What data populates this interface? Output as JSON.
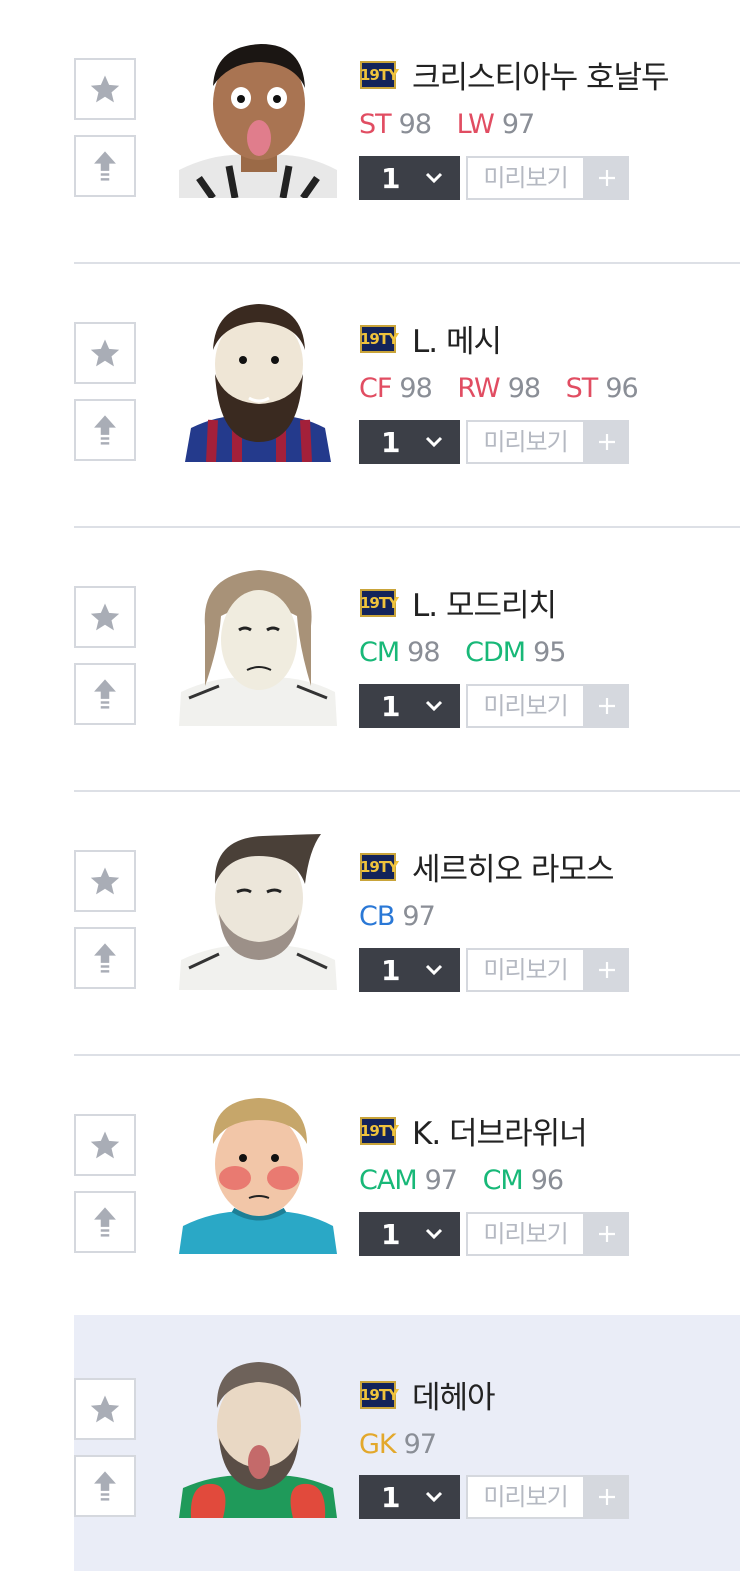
{
  "preview_label": "미리보기",
  "players": [
    {
      "season_badge": "19TY",
      "name": "크리스티아누 호날두",
      "grade": "1",
      "positions": [
        {
          "code": "ST",
          "ovr": "98",
          "group": "fw"
        },
        {
          "code": "LW",
          "ovr": "97",
          "group": "fw"
        }
      ],
      "highlight": false
    },
    {
      "season_badge": "19TY",
      "name": "L. 메시",
      "grade": "1",
      "positions": [
        {
          "code": "CF",
          "ovr": "98",
          "group": "fw"
        },
        {
          "code": "RW",
          "ovr": "98",
          "group": "fw"
        },
        {
          "code": "ST",
          "ovr": "96",
          "group": "fw"
        }
      ],
      "highlight": false
    },
    {
      "season_badge": "19TY",
      "name": "L. 모드리치",
      "grade": "1",
      "positions": [
        {
          "code": "CM",
          "ovr": "98",
          "group": "mf"
        },
        {
          "code": "CDM",
          "ovr": "95",
          "group": "mf"
        }
      ],
      "highlight": false
    },
    {
      "season_badge": "19TY",
      "name": "세르히오 라모스",
      "grade": "1",
      "positions": [
        {
          "code": "CB",
          "ovr": "97",
          "group": "df"
        }
      ],
      "highlight": false
    },
    {
      "season_badge": "19TY",
      "name": "K. 더브라위너",
      "grade": "1",
      "positions": [
        {
          "code": "CAM",
          "ovr": "97",
          "group": "mf"
        },
        {
          "code": "CM",
          "ovr": "96",
          "group": "mf"
        }
      ],
      "highlight": false
    },
    {
      "season_badge": "19TY",
      "name": "데헤아",
      "grade": "1",
      "positions": [
        {
          "code": "GK",
          "ovr": "97",
          "group": "gk"
        }
      ],
      "highlight": true
    }
  ]
}
